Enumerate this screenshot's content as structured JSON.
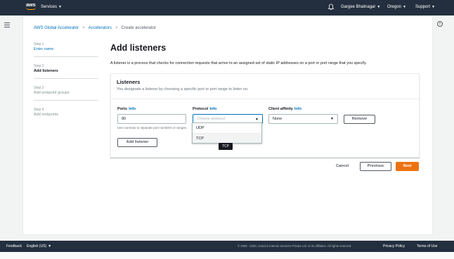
{
  "topnav": {
    "logo_text": "aws",
    "services_label": "Services",
    "user_label": "Gargee Bhatnagar",
    "region_label": "Oregon",
    "support_label": "Support"
  },
  "breadcrumb": {
    "items": [
      "AWS Global Accelerator",
      "Accelerators",
      "Create accelerator"
    ]
  },
  "steps": [
    {
      "num": "Step 1",
      "name": "Enter name",
      "state": "link"
    },
    {
      "num": "Step 2",
      "name": "Add listeners",
      "state": "active"
    },
    {
      "num": "Step 3",
      "name": "Add endpoint groups",
      "state": "disabled"
    },
    {
      "num": "Step 4",
      "name": "Add endpoints",
      "state": "disabled"
    }
  ],
  "page": {
    "title": "Add listeners",
    "description": "A listener is a process that checks for connection requests that arrive to an assigned set of static IP addresses on a port or port range that you specify."
  },
  "listeners": {
    "title": "Listeners",
    "subtitle": "You designate a listener by choosing a specific port or port range to listen on.",
    "ports_label": "Ports",
    "protocol_label": "Protocol",
    "affinity_label": "Client affinity",
    "info_link": "Info",
    "ports_value": "80",
    "ports_hint": "Use commas to separate port numbers or ranges.",
    "protocol_placeholder": "Choose protocol",
    "affinity_value": "None",
    "remove_label": "Remove",
    "add_listener_label": "Add listener",
    "protocol_options": [
      "UDP",
      "TCP"
    ],
    "tooltip": "TCP"
  },
  "actions": {
    "cancel": "Cancel",
    "previous": "Previous",
    "next": "Next"
  },
  "footer": {
    "feedback": "Feedback",
    "language": "English (US)",
    "copyright": "© 2008 - 2020, Amazon Internet Services Private Ltd. or its affiliates. All rights reserved.",
    "privacy": "Privacy Policy",
    "terms": "Terms of Use"
  },
  "colors": {
    "nav_bg": "#232f3e",
    "link": "#0073bb",
    "primary_button": "#ec7211",
    "aws_orange": "#ff9900"
  }
}
